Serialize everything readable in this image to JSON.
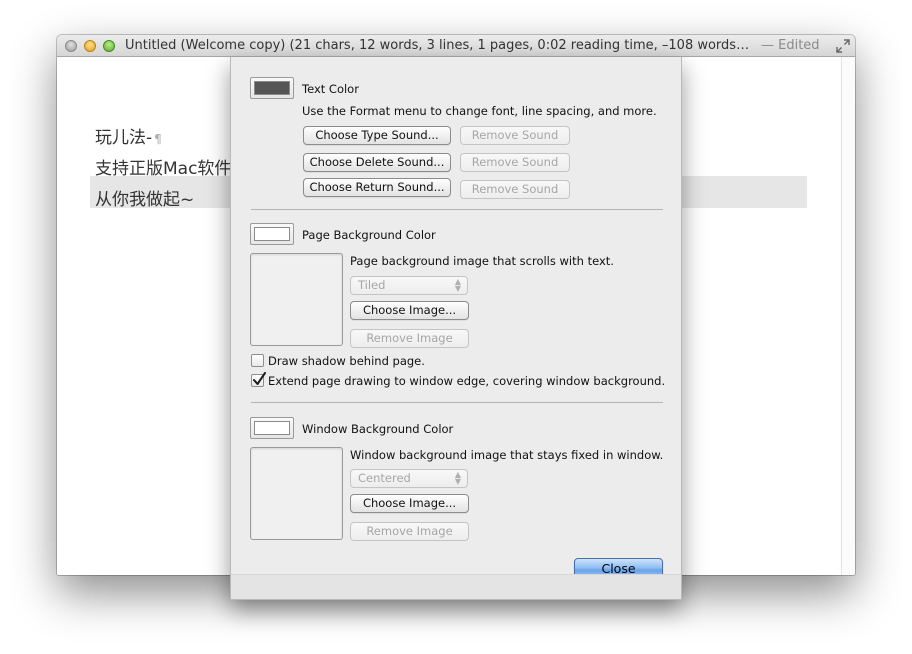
{
  "window": {
    "title": "Untitled (Welcome copy) (21 chars, 12 words, 3 lines, 1 pages, 0:02 reading time, –108 words in…",
    "edited_label": "— Edited"
  },
  "document": {
    "lines": [
      "玩儿法-",
      "支持正版Mac软件",
      "从你我做起~"
    ],
    "pilcrow": "¶"
  },
  "sheet": {
    "text_color": {
      "label": "Text Color",
      "swatch_color": "#555555",
      "hint": "Use the Format menu to change font, line spacing, and more.",
      "choose_type_sound": "Choose Type Sound...",
      "choose_delete_sound": "Choose Delete Sound...",
      "choose_return_sound": "Choose Return Sound...",
      "remove_sound": "Remove Sound"
    },
    "page_background": {
      "label": "Page Background Color",
      "swatch_color": "#ffffff",
      "description": "Page background image that scrolls with text.",
      "mode": "Tiled",
      "choose_image": "Choose Image...",
      "remove_image": "Remove Image",
      "draw_shadow_label": "Draw shadow behind page.",
      "draw_shadow_checked": false,
      "extend_label": "Extend page drawing to window edge, covering window background.",
      "extend_checked": true
    },
    "window_background": {
      "label": "Window Background Color",
      "swatch_color": "#ffffff",
      "description": "Window background image that stays fixed in window.",
      "mode": "Centered",
      "choose_image": "Choose Image...",
      "remove_image": "Remove Image"
    },
    "close_label": "Close"
  },
  "colors": {
    "close_button_accent": "#6aa3ea",
    "line_highlight": "#e6e6e6"
  }
}
